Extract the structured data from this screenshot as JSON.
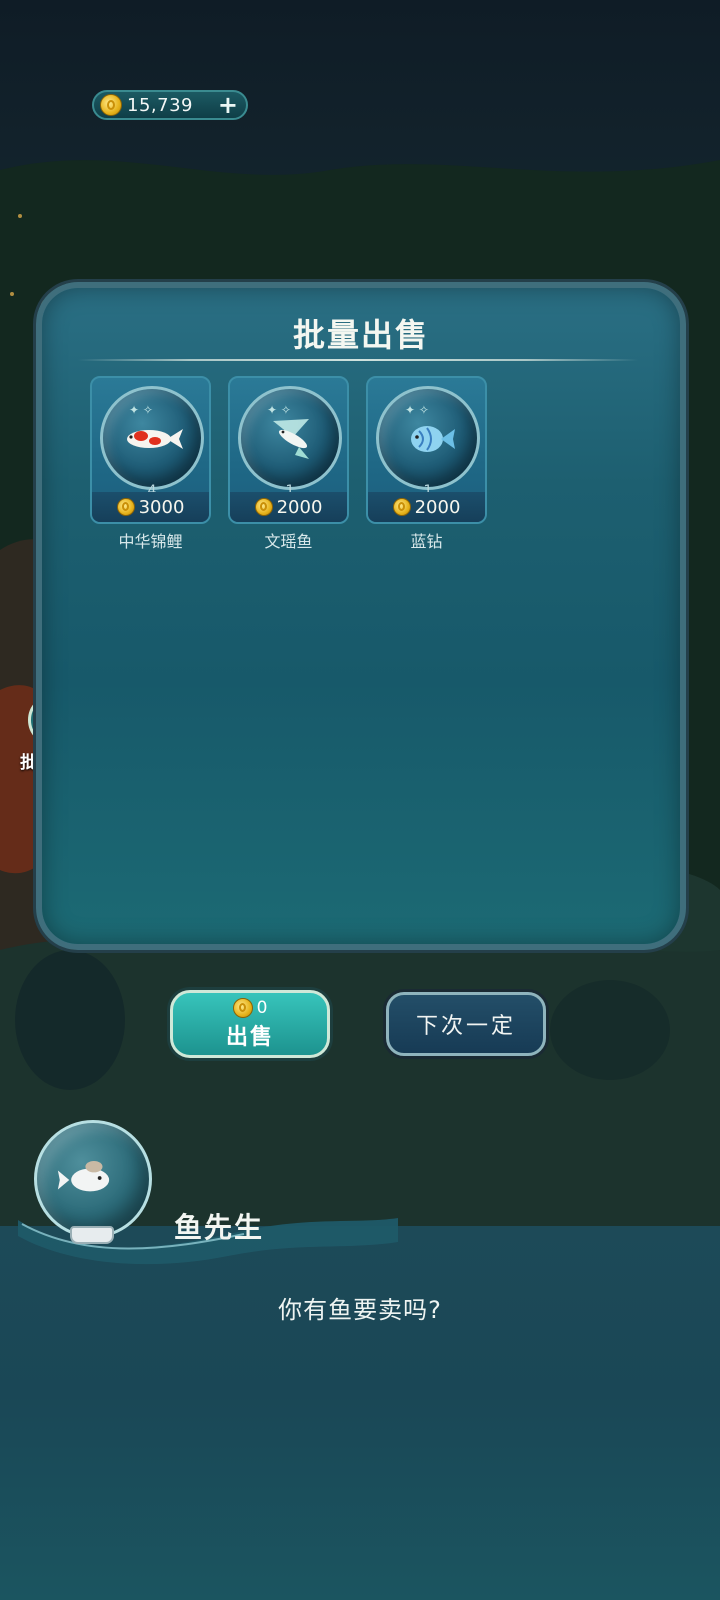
{
  "wallet": {
    "coins": "15,739",
    "add_label": "+"
  },
  "side_menu": {
    "batch_sell_label": "批量出售"
  },
  "panel": {
    "title": "批量出售",
    "items": [
      {
        "name": "中华锦鲤",
        "quantity": "4",
        "price": "3000",
        "icon": "koi-fish-icon"
      },
      {
        "name": "文瑶鱼",
        "quantity": "1",
        "price": "2000",
        "icon": "flying-fish-icon"
      },
      {
        "name": "蓝钻",
        "quantity": "1",
        "price": "2000",
        "icon": "blue-diamond-fish-icon"
      }
    ]
  },
  "actions": {
    "sell_amount": "0",
    "sell_label": "出售",
    "next_time_label": "下次一定"
  },
  "dialogue": {
    "speaker": "鱼先生",
    "text": "你有鱼要卖吗?"
  },
  "colors": {
    "panel": "#1d5f70",
    "sell_button": "#2db0a8",
    "next_button": "#1d4560",
    "coin": "#e6b21a"
  }
}
